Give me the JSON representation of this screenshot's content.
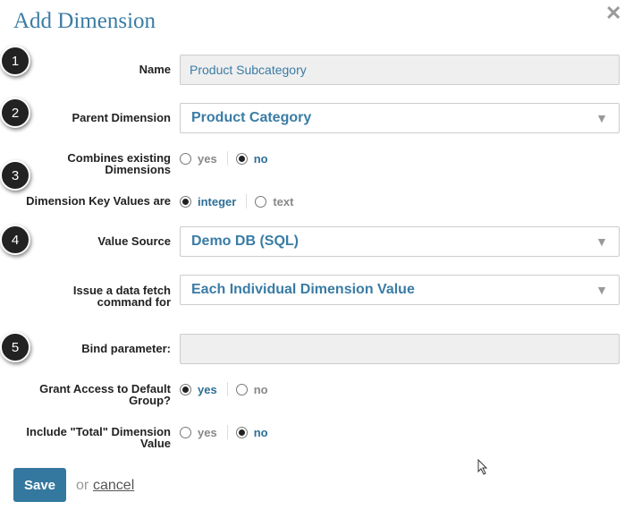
{
  "dialog": {
    "title": "Add Dimension",
    "close_glyph": "✕"
  },
  "steps": [
    "1",
    "2",
    "3",
    "4",
    "5"
  ],
  "fields": {
    "name": {
      "label": "Name",
      "value": "Product Subcategory"
    },
    "parent": {
      "label": "Parent Dimension",
      "value": "Product Category"
    },
    "combines": {
      "label_line1": "Combines existing",
      "label_line2": "Dimensions",
      "opt_yes": "yes",
      "opt_no": "no",
      "selected": "no"
    },
    "key_values": {
      "label": "Dimension Key Values are",
      "opt_integer": "integer",
      "opt_text": "text",
      "selected": "integer"
    },
    "value_source": {
      "label": "Value Source",
      "value": "Demo DB (SQL)"
    },
    "fetch": {
      "label_line1": "Issue a data fetch",
      "label_line2": "command for",
      "value": "Each Individual Dimension Value"
    },
    "bind": {
      "label": "Bind parameter:",
      "value": ""
    },
    "grant": {
      "label_line1": "Grant Access to Default",
      "label_line2": "Group?",
      "opt_yes": "yes",
      "opt_no": "no",
      "selected": "yes"
    },
    "total": {
      "label_line1": "Include \"Total\" Dimension",
      "label_line2": "Value",
      "opt_yes": "yes",
      "opt_no": "no",
      "selected": "no"
    }
  },
  "actions": {
    "save": "Save",
    "or": "or",
    "cancel": "cancel"
  },
  "icons": {
    "caret": "▼",
    "close": "close-icon"
  },
  "colors": {
    "accent": "#3a7ca5",
    "button": "#34789f",
    "badge": "#222222"
  }
}
